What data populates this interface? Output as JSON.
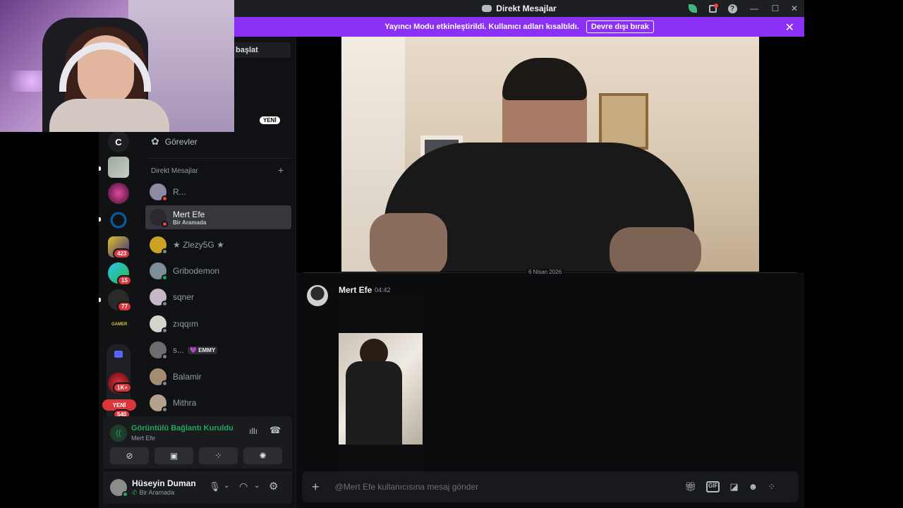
{
  "window": {
    "title": "Direkt Mesajlar"
  },
  "banner": {
    "text": "Yayıncı Modu etkinleştirildi. Kullanıcı adları kısaltıldı.",
    "button": "Devre dışı bırak"
  },
  "search": {
    "label": "başlat"
  },
  "new_badge_top": "YENİ",
  "home_initial": "C",
  "quests_label": "Görevler",
  "dm_header": "Direkt Mesajlar",
  "dm_add": "+",
  "dms": [
    {
      "name": "R...",
      "status": "#f23f43",
      "avatar_color": "#8d8aa6"
    },
    {
      "name": "Mert Efe",
      "sub": "Bir Aramada",
      "status": "#f23f43",
      "avatar_color": "#2a2a2e",
      "active": true
    },
    {
      "name": "★ Zlezy5G ★",
      "status": "#80848e",
      "avatar_color": "#c9a227"
    },
    {
      "name": "Gribodemon",
      "status": "#23a55a",
      "avatar_color": "#7f8e96"
    },
    {
      "name": "sqner",
      "status": "#80848e",
      "avatar_color": "#c6b6c9"
    },
    {
      "name": "zıqqım",
      "status": "#80848e",
      "avatar_color": "#d6d2cd"
    },
    {
      "name": "s...",
      "tag": "💜 EMMY",
      "status": "#80848e",
      "avatar_color": "#6d6d6d"
    },
    {
      "name": "Balamir",
      "status": "#80848e",
      "avatar_color": "#a58b6f"
    },
    {
      "name": "Mithra",
      "status": "#80848e",
      "avatar_color": "#b3a18d"
    }
  ],
  "servers": {
    "badges": [
      "423",
      "15",
      "77",
      "1K+",
      "540"
    ],
    "new_pill": "YENİ",
    "gamer_label": "GAMER"
  },
  "voice": {
    "status": "Görüntülü Bağlantı Kuruldu",
    "channel": "Mert Efe"
  },
  "user": {
    "name": "Hüseyin Duman",
    "status": "Bir Aramada"
  },
  "chat": {
    "date_divider": "6 Nisan 2026",
    "message": {
      "author": "Mert Efe",
      "time": "04:42"
    },
    "input_placeholder": "@Mert Efe kullanıcısına mesaj gönder"
  },
  "colors": {
    "accent": "#8b31f5",
    "online": "#23a55a",
    "dnd": "#f23f43",
    "voice_green": "#23a55a"
  }
}
